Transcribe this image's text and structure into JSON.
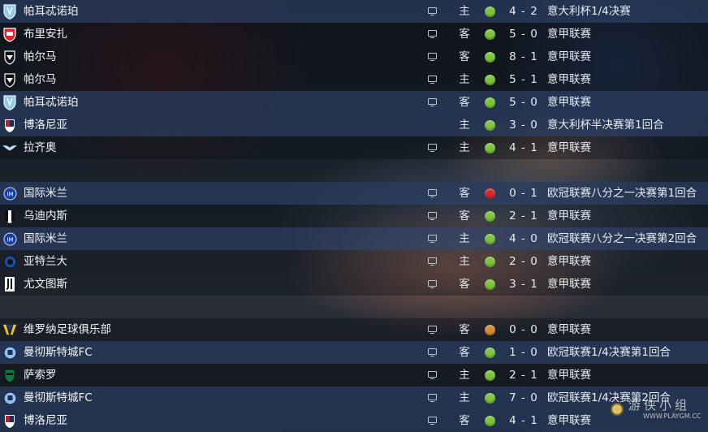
{
  "colors": {
    "win": "#7cc43a",
    "loss": "#d42a2a",
    "draw": "#d98a2e"
  },
  "matches": [
    {
      "team": "帕耳忒诺珀",
      "crest": "napoli-crest-icon",
      "tv": true,
      "venue": "主",
      "result": "win",
      "score": "4 - 2",
      "competition": "意大利杯1/4决赛"
    },
    {
      "team": "布里安扎",
      "crest": "monza-crest-icon",
      "tv": true,
      "venue": "客",
      "result": "win",
      "score": "5 - 0",
      "competition": "意甲联赛"
    },
    {
      "team": "帕尔马",
      "crest": "parma-crest-icon",
      "tv": true,
      "venue": "客",
      "result": "win",
      "score": "8 - 1",
      "competition": "意甲联赛"
    },
    {
      "team": "帕尔马",
      "crest": "parma-crest-icon",
      "tv": true,
      "venue": "主",
      "result": "win",
      "score": "5 - 1",
      "competition": "意甲联赛"
    },
    {
      "team": "帕耳忒诺珀",
      "crest": "napoli-crest-icon",
      "tv": true,
      "venue": "客",
      "result": "win",
      "score": "5 - 0",
      "competition": "意甲联赛"
    },
    {
      "team": "博洛尼亚",
      "crest": "bologna-crest-icon",
      "tv": false,
      "venue": "主",
      "result": "win",
      "score": "3 - 0",
      "competition": "意大利杯半决赛第1回合"
    },
    {
      "team": "拉齐奥",
      "crest": "lazio-crest-icon",
      "tv": true,
      "venue": "主",
      "result": "win",
      "score": "4 - 1",
      "competition": "意甲联赛"
    },
    null,
    {
      "team": "国际米兰",
      "crest": "inter-crest-icon",
      "tv": true,
      "venue": "客",
      "result": "loss",
      "score": "0 - 1",
      "competition": "欧冠联赛八分之一决赛第1回合"
    },
    {
      "team": "乌迪内斯",
      "crest": "udinese-crest-icon",
      "tv": true,
      "venue": "客",
      "result": "win",
      "score": "2 - 1",
      "competition": "意甲联赛"
    },
    {
      "team": "国际米兰",
      "crest": "inter-crest-icon",
      "tv": true,
      "venue": "主",
      "result": "win",
      "score": "4 - 0",
      "competition": "欧冠联赛八分之一决赛第2回合"
    },
    {
      "team": "亚特兰大",
      "crest": "atalanta-crest-icon",
      "tv": true,
      "venue": "主",
      "result": "win",
      "score": "2 - 0",
      "competition": "意甲联赛"
    },
    {
      "team": "尤文图斯",
      "crest": "juventus-crest-icon",
      "tv": true,
      "venue": "客",
      "result": "win",
      "score": "3 - 1",
      "competition": "意甲联赛"
    },
    null,
    {
      "team": "维罗纳足球俱乐部",
      "crest": "verona-crest-icon",
      "tv": true,
      "venue": "客",
      "result": "draw",
      "score": "0 - 0",
      "competition": "意甲联赛"
    },
    {
      "team": "曼彻斯特城FC",
      "crest": "mancity-crest-icon",
      "tv": true,
      "venue": "客",
      "result": "win",
      "score": "1 - 0",
      "competition": "欧冠联赛1/4决赛第1回合"
    },
    {
      "team": "萨索罗",
      "crest": "sassuolo-crest-icon",
      "tv": true,
      "venue": "主",
      "result": "win",
      "score": "2 - 1",
      "competition": "意甲联赛"
    },
    {
      "team": "曼彻斯特城FC",
      "crest": "mancity-crest-icon",
      "tv": true,
      "venue": "主",
      "result": "win",
      "score": "7 - 0",
      "competition": "欧冠联赛1/4决赛第2回合"
    },
    {
      "team": "博洛尼亚",
      "crest": "bologna-crest-icon",
      "tv": true,
      "venue": "客",
      "result": "win",
      "score": "4 - 1",
      "competition": "意甲联赛"
    }
  ],
  "watermark": {
    "text": "游侠小组",
    "url": "WWW.PLAYGM.CC"
  }
}
